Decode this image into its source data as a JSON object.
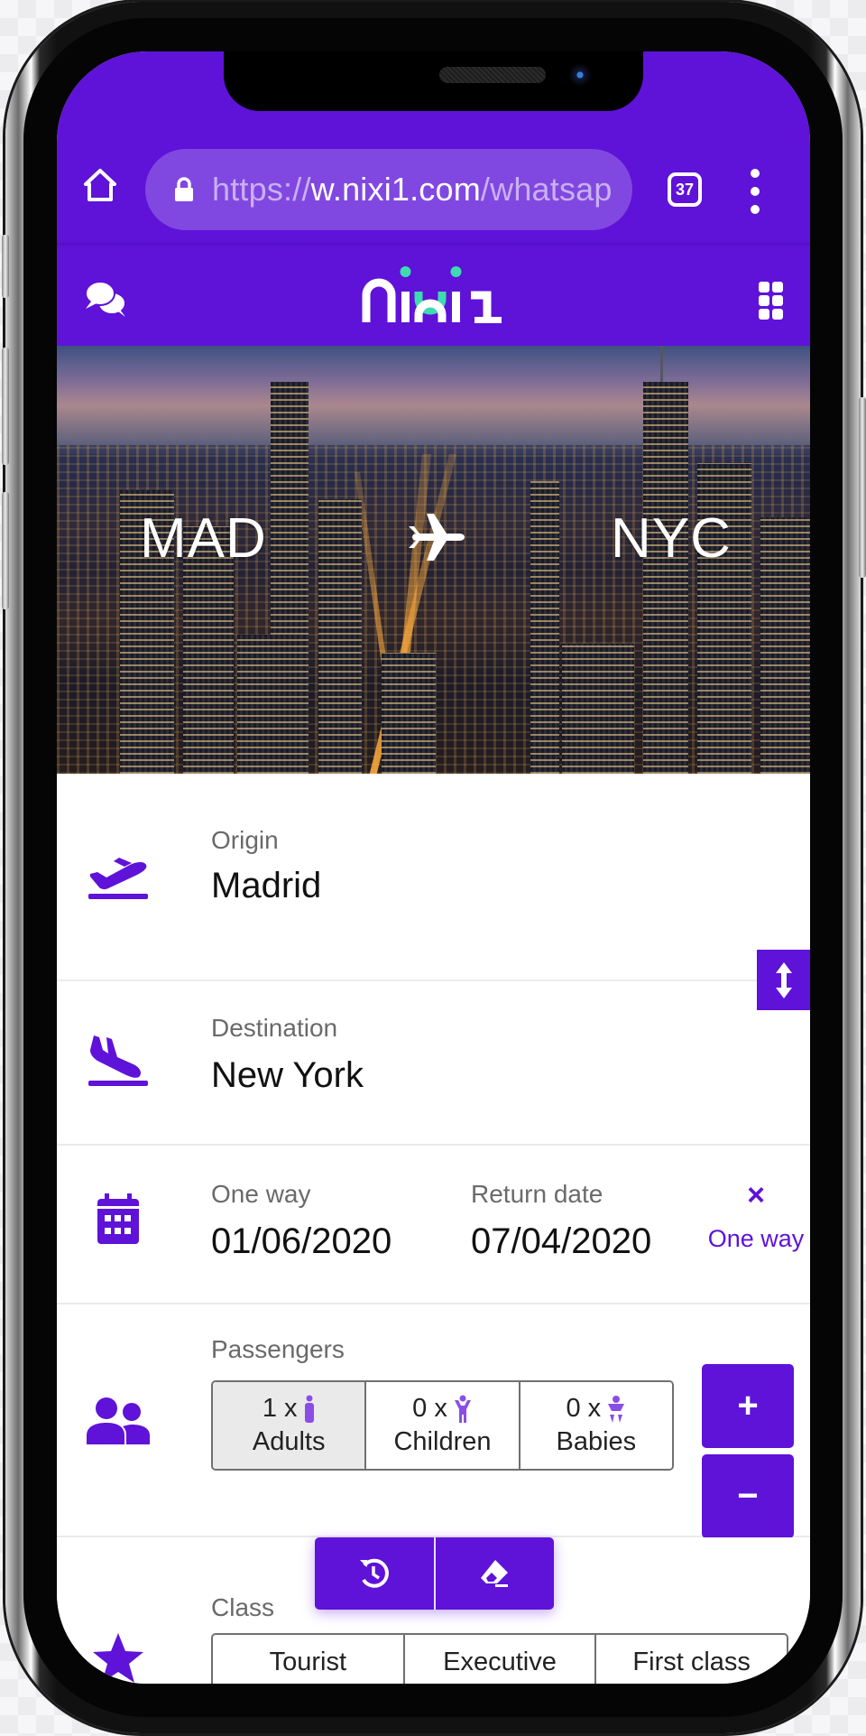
{
  "browser": {
    "url_scheme": "https://",
    "url_host": "w.nixi1.com",
    "url_path": "/whatsap",
    "tab_count": "37"
  },
  "app": {
    "brand": "nixi1",
    "brand_colors": {
      "primary": "#5f12d8",
      "accent": "#3ddbb0"
    }
  },
  "hero": {
    "origin_code": "MAD",
    "destination_code": "NYC"
  },
  "form": {
    "origin": {
      "label": "Origin",
      "value": "Madrid"
    },
    "destination": {
      "label": "Destination",
      "value": "New York"
    },
    "dates": {
      "departure_label": "One way",
      "departure_value": "01/06/2020",
      "return_label": "Return date",
      "return_value": "07/04/2020",
      "one_way_button": "One way",
      "one_way_icon": "×"
    },
    "passengers": {
      "label": "Passengers",
      "groups": [
        {
          "count": "1 x",
          "name": "Adults",
          "selected": true
        },
        {
          "count": "0 x",
          "name": "Children",
          "selected": false
        },
        {
          "count": "0 x",
          "name": "Babies",
          "selected": false
        }
      ],
      "increment": "+",
      "decrement": "−"
    },
    "class": {
      "label": "Class",
      "options": [
        "Tourist",
        "Executive",
        "First class"
      ]
    }
  }
}
